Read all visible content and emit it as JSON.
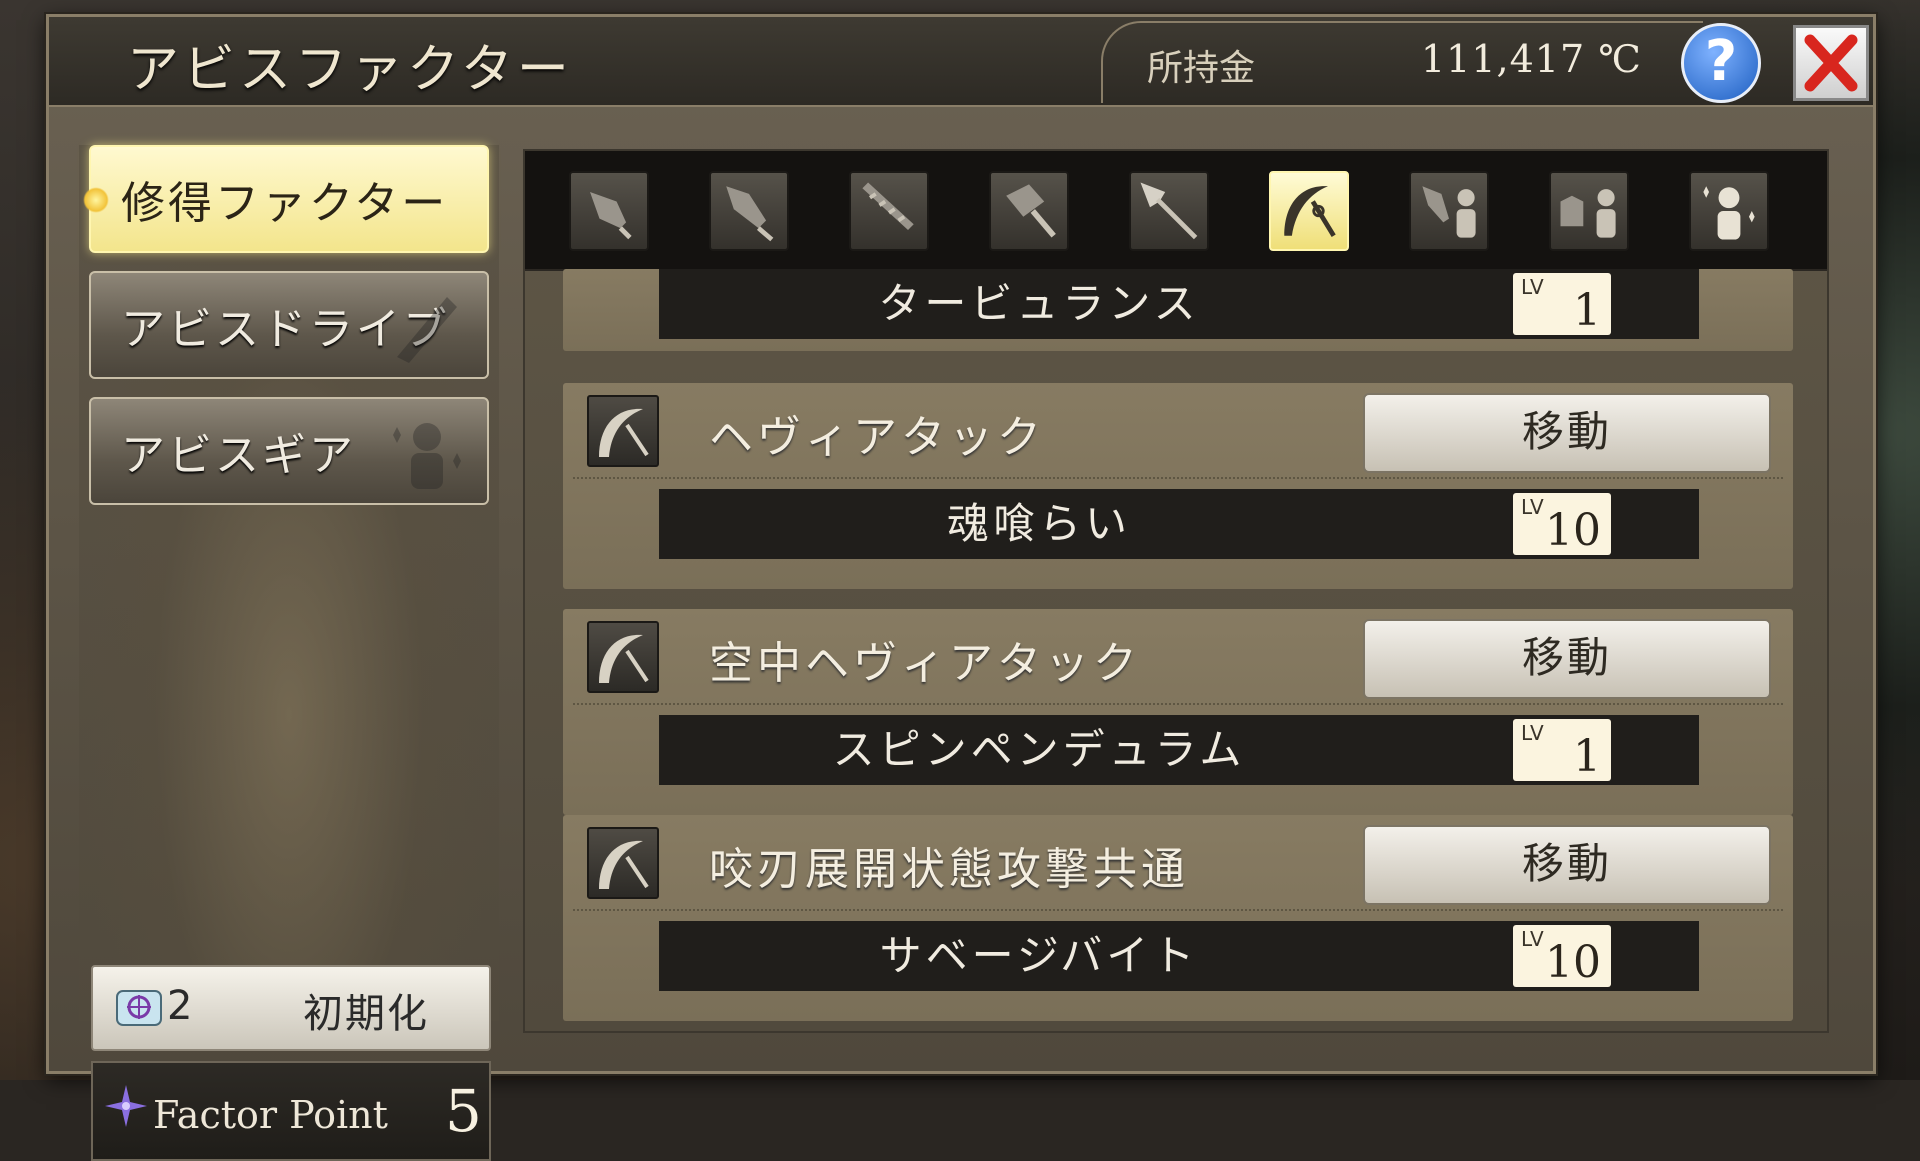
{
  "header": {
    "title": "アビスファクター",
    "money_label": "所持金",
    "money_value": "111,417 ℃",
    "help_label": "?"
  },
  "sidebar": {
    "items": [
      {
        "label": "修得ファクター",
        "active": true
      },
      {
        "label": "アビスドライブ",
        "active": false
      },
      {
        "label": "アビスギア",
        "active": false
      }
    ],
    "reset_count": "2",
    "reset_label": "初期化",
    "factor_point_label": "Factor Point",
    "factor_point_value": "5"
  },
  "weapon_tabs": [
    {
      "icon": "short-sword-icon"
    },
    {
      "icon": "long-sword-icon"
    },
    {
      "icon": "serrated-blade-icon"
    },
    {
      "icon": "hammer-icon"
    },
    {
      "icon": "spear-icon"
    },
    {
      "icon": "scythe-icon",
      "active": true
    },
    {
      "icon": "sword-ally-icon"
    },
    {
      "icon": "armor-ally-icon"
    },
    {
      "icon": "ally-icon"
    }
  ],
  "top_factor": {
    "name": "タービュランス",
    "lv_tag": "LV",
    "lv": "1"
  },
  "factors": [
    {
      "skill": "ヘヴィアタック",
      "move_label": "移動",
      "factor": "魂喰らい",
      "lv_tag": "LV",
      "lv": "10"
    },
    {
      "skill": "空中ヘヴィアタック",
      "move_label": "移動",
      "factor": "スピンペンデュラム",
      "lv_tag": "LV",
      "lv": "1"
    },
    {
      "skill": "咬刃展開状態攻撃共通",
      "move_label": "移動",
      "factor": "サベージバイト",
      "lv_tag": "LV",
      "lv": "10"
    }
  ]
}
